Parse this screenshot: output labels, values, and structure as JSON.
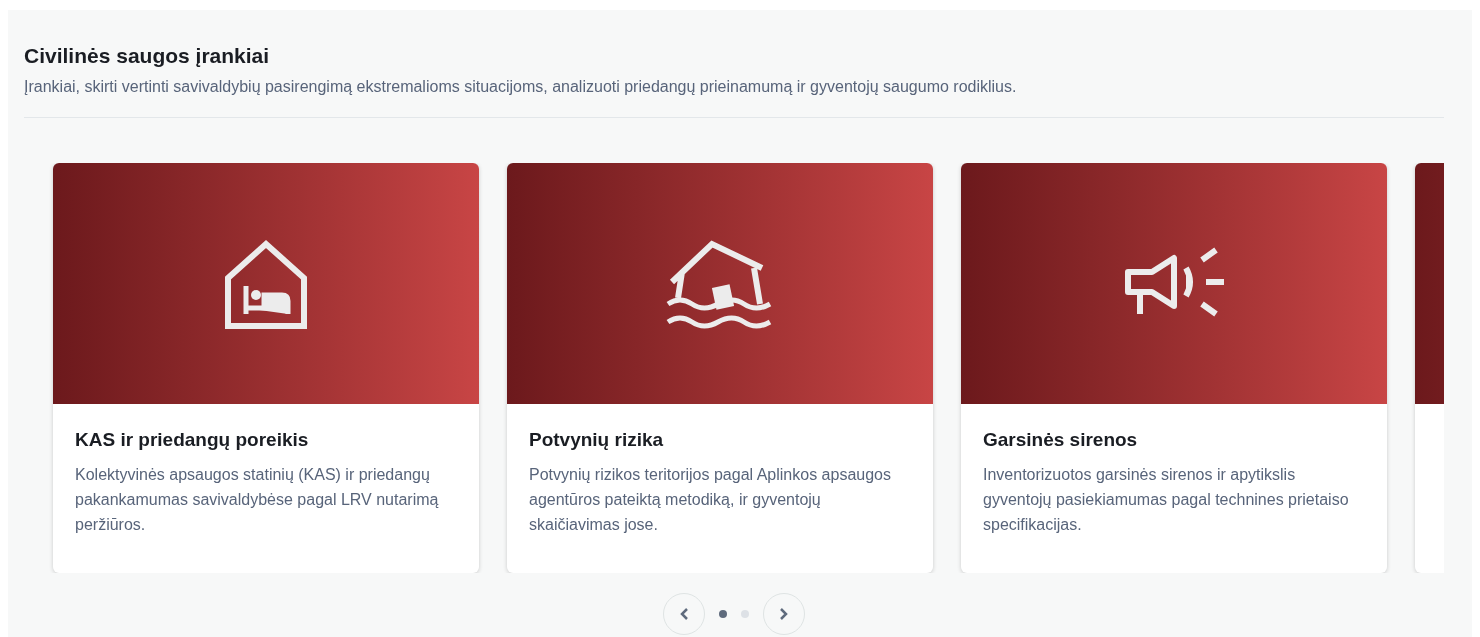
{
  "section": {
    "title": "Civilinės saugos įrankiai",
    "description": "Įrankiai, skirti vertinti savivaldybių pasirengimą ekstremalioms situacijoms, analizuoti priedangų prieinamumą ir gyventojų saugumo rodiklius."
  },
  "cards": [
    {
      "kind": "shelter",
      "title": "KAS ir priedangų poreikis",
      "description": "Kolektyvinės apsaugos statinių (KAS) ir priedangų pakankamumas savivaldybėse pagal LRV nutarimą peržiūros."
    },
    {
      "kind": "flood",
      "title": "Potvynių rizika",
      "description": "Potvynių rizikos teritorijos pagal Aplinkos apsaugos agentūros pateiktą metodiką, ir gyventojų skaičiavimas jose."
    },
    {
      "kind": "siren",
      "title": "Garsinės sirenos",
      "description": "Inventorizuotos garsinės sirenos ir apytikslis gyventojų pasiekiamumas pagal technines prietaiso specifikacijas."
    },
    {
      "kind": "partial"
    }
  ],
  "pagination": {
    "dots": [
      {
        "selected": true
      },
      {
        "selected": false
      }
    ]
  }
}
